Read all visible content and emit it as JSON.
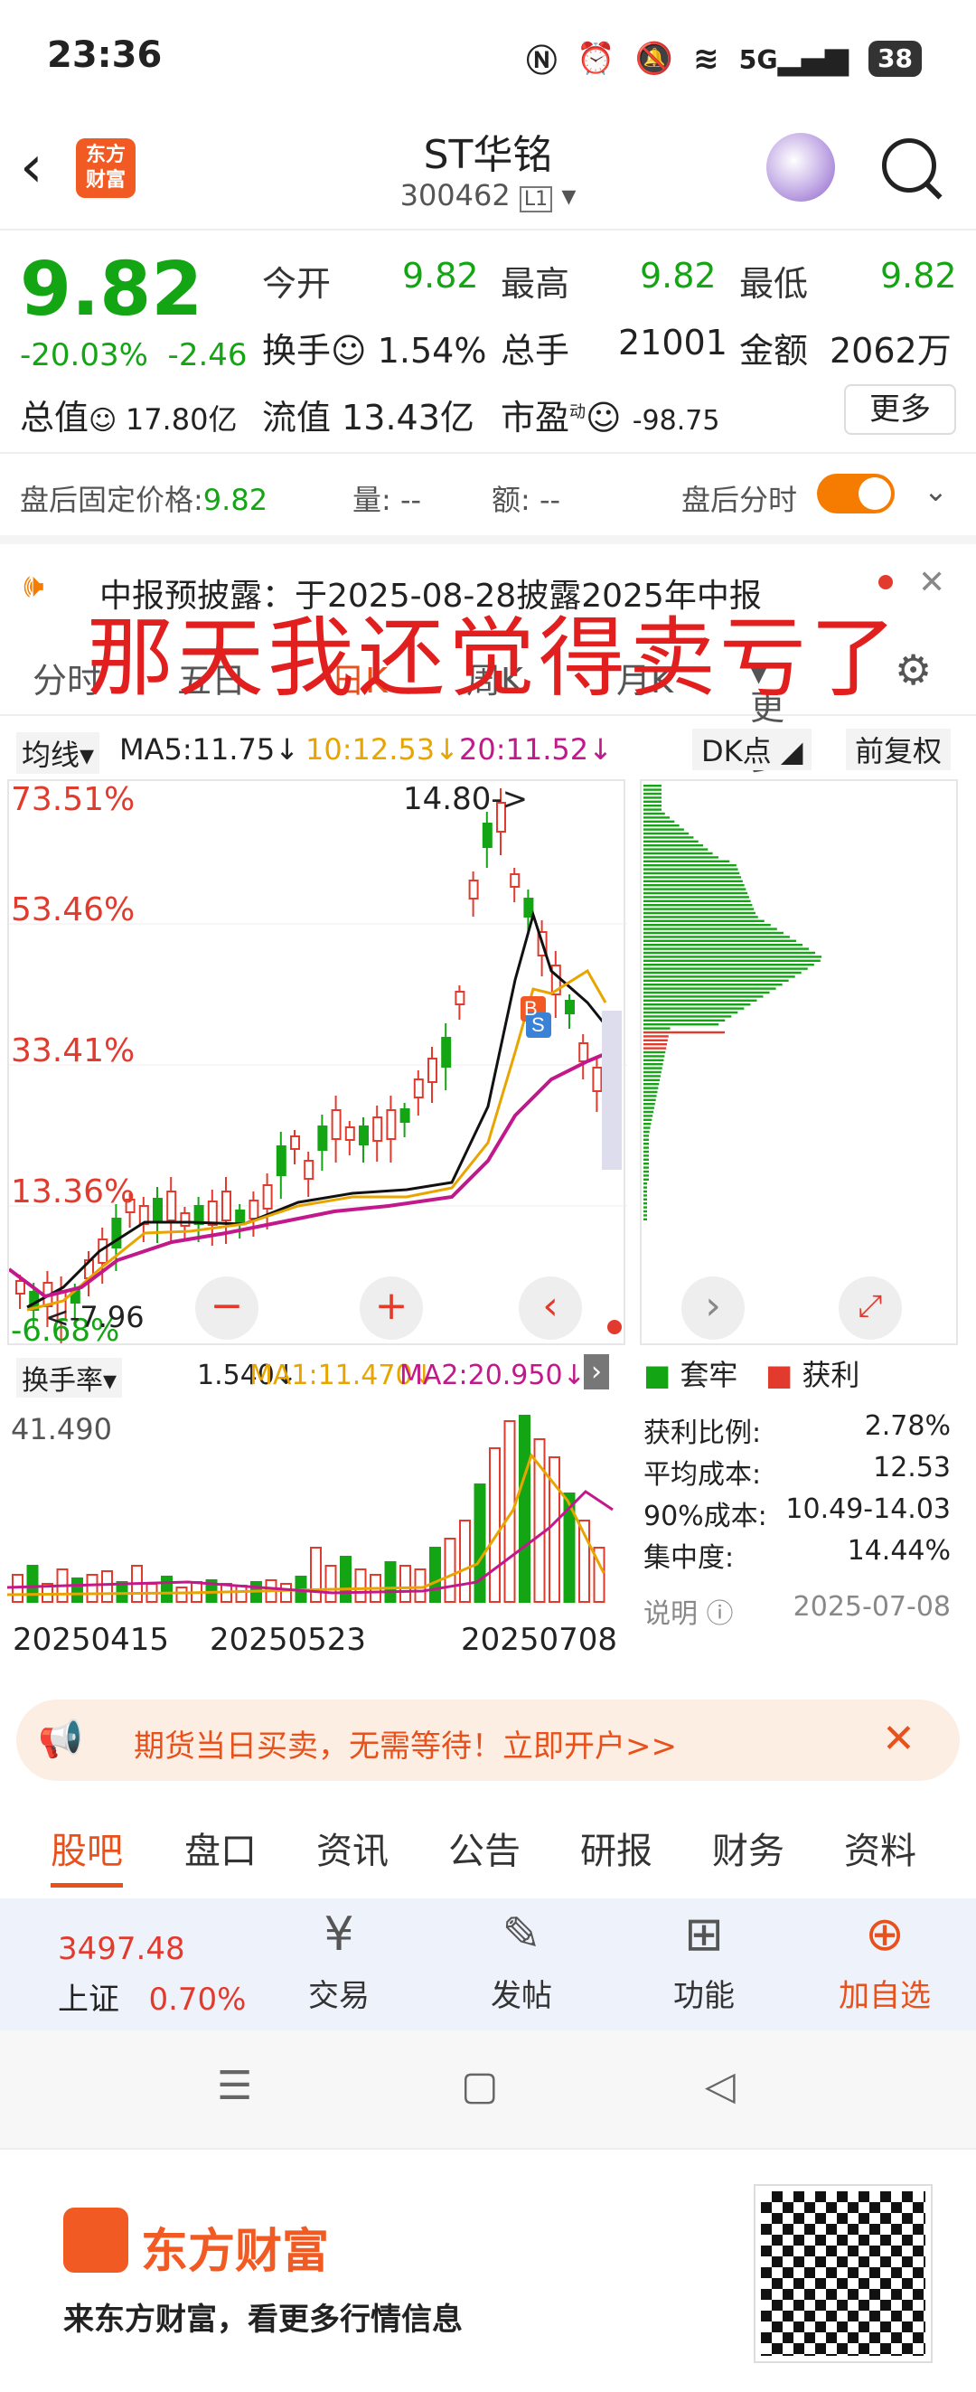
{
  "status": {
    "time": "23:36",
    "net": "5G",
    "battery": "38"
  },
  "header": {
    "title": "ST华铭",
    "code": "300462",
    "level": "L1",
    "logo": "东方\n财富"
  },
  "quote": {
    "price": "9.82",
    "pct": "-20.03%",
    "chg": "-2.46",
    "open_l": "今开",
    "open": "9.82",
    "high_l": "最高",
    "high": "9.82",
    "low_l": "最低",
    "low": "9.82",
    "turn_l": "换手",
    "turn": "1.54%",
    "vol_l": "总手",
    "vol": "21001",
    "amt_l": "金额",
    "amt": "2062万",
    "mcap_l": "总值",
    "mcap": "17.80亿",
    "float_l": "流值",
    "float": "13.43亿",
    "pe_l": "市盈",
    "pe": "-98.75",
    "pe_sup": "动",
    "more": "更多"
  },
  "afterhours": {
    "fixed_l": "盘后固定价格:",
    "fixed": "9.82",
    "vol": "量: --",
    "amt": "额: --",
    "switch": "盘后分时"
  },
  "notice": {
    "text": "中报预披露：于2025-08-28披露2025年中报"
  },
  "overlay": "那天我还觉得卖亏了",
  "tabs1": [
    "分时",
    "五日",
    "日K",
    "周K",
    "月K",
    "更多"
  ],
  "ma": {
    "sel": "均线",
    "ma5": "MA5:11.75↓",
    "ma10": "10:12.53↓",
    "ma20": "20:11.52↓",
    "dk": "DK点",
    "fq": "前复权"
  },
  "chart_data": {
    "type": "candlestick",
    "y_ticks": [
      "73.51%",
      "53.46%",
      "33.41%",
      "13.36%",
      "-6.68%"
    ],
    "annotations": [
      "14.80->",
      "<-7.96"
    ],
    "dates": [
      "20250415",
      "20250523",
      "20250708"
    ]
  },
  "vol": {
    "sel": "换手率",
    "v": "1.540↓",
    "ma1": "MA1:11.470↓",
    "ma2": "MA2:20.950↓",
    "max": "41.490"
  },
  "chip": {
    "legend_trap": "套牢",
    "legend_profit": "获利",
    "rows": [
      {
        "k": "获利比例:",
        "v": "2.78%"
      },
      {
        "k": "平均成本:",
        "v": "12.53"
      },
      {
        "k": "90%成本:",
        "v": "10.49-14.03"
      },
      {
        "k": "集中度:",
        "v": "14.44%"
      }
    ],
    "note": "说明",
    "date": "2025-07-08"
  },
  "banner": "期货当日买卖，无需等待！立即开户>>",
  "tabs2": [
    "股吧",
    "盘口",
    "资讯",
    "公告",
    "研报",
    "财务",
    "资料"
  ],
  "bottom": {
    "index_val": "3497.48",
    "index_name": "上证",
    "index_pct": "0.70%",
    "trade": "交易",
    "post": "发帖",
    "func": "功能",
    "add": "加自选"
  },
  "footer": {
    "brand": "东方财富",
    "slogan": "来东方财富，看更多行情信息"
  }
}
